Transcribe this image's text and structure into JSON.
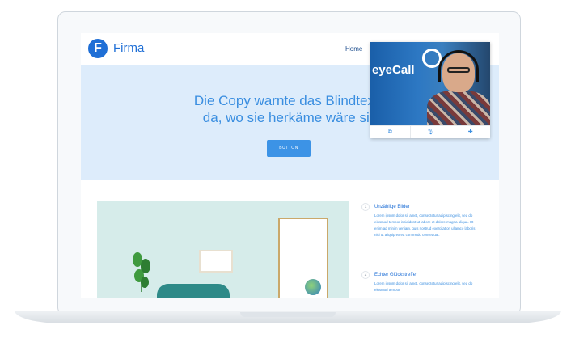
{
  "site": {
    "brand": "Firma",
    "logo_letter": "F",
    "nav": {
      "home": "Home"
    }
  },
  "hero": {
    "title_line1": "Die Copy warnte das Blindtexto",
    "title_line2": "da, wo sie herkäme wäre sie",
    "button": "BUTTON"
  },
  "features": [
    {
      "number": "1",
      "title": "Unzählige Bilder",
      "body": "Lorem ipsum dolor sit amet, consectetur adipiscing elit, sed do eiusmod tempor incididunt ut labore et dolore magna aliqua. Ut enim ad minim veniam, quis nostrud exercitation ullamco laboris nisi ut aliquip ex ea commodo consequat."
    },
    {
      "number": "2",
      "title": "Echter Glückstreffer",
      "body": "Lorem ipsum dolor sit amet, consectetur adipiscing elit, sed do eiusmod tempor"
    }
  ],
  "video_call": {
    "logo_text": "eyeCall",
    "controls": [
      "⧉",
      "🎙",
      "✚"
    ]
  },
  "colors": {
    "accent": "#1f6fd6",
    "hero_bg": "#ddecfb",
    "hero_text": "#3a8ee0",
    "button_bg": "#3c93e6"
  }
}
